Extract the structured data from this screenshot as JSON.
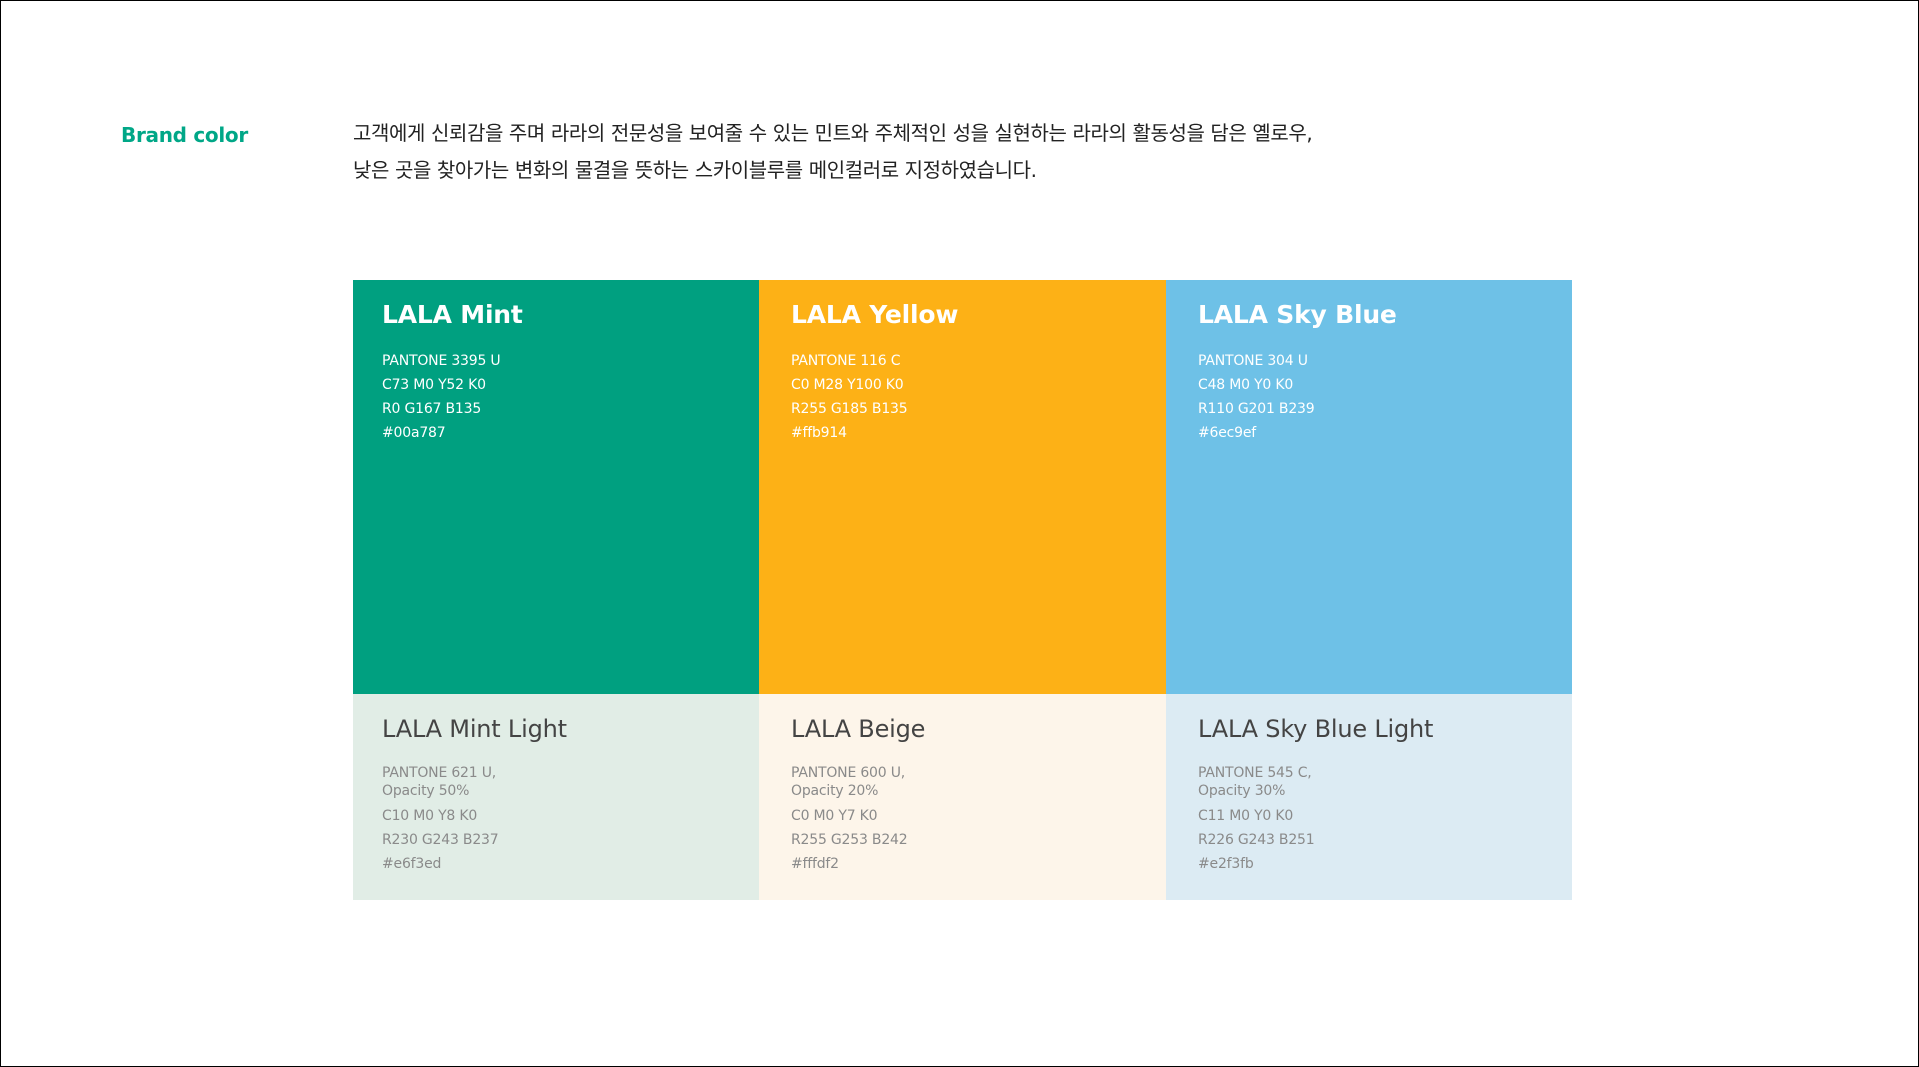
{
  "section_label": "Brand color",
  "accent_color": "#00a787",
  "intro": {
    "line1": "고객에게 신뢰감을 주며 라라의 전문성을 보여줄 수 있는 민트와 주체적인 성을 실현하는 라라의 활동성을 담은 옐로우,",
    "line2": "낮은 곳을 찾아가는 변화의 물결을 뜻하는 스카이블루를 메인컬러로 지정하였습니다."
  },
  "primary": [
    {
      "name": "LALA Mint",
      "pantone": "PANTONE 3395 U",
      "cmyk": "C73 M0 Y52 K0",
      "rgb": "R0 G167 B135",
      "hex": "#00a787",
      "color": "#00a080"
    },
    {
      "name": "LALA Yellow",
      "pantone": "PANTONE 116 C",
      "cmyk": "C0 M28 Y100 K0",
      "rgb": "R255 G185 B135",
      "hex": "#ffb914",
      "color": "#fdb116"
    },
    {
      "name": "LALA Sky Blue",
      "pantone": "PANTONE 304 U",
      "cmyk": "C48 M0 Y0 K0",
      "rgb": "R110 G201 B239",
      "hex": "#6ec9ef",
      "color": "#6ec1e7"
    }
  ],
  "secondary": [
    {
      "name": "LALA Mint Light",
      "pantone": "PANTONE 621 U,",
      "opacity": "Opacity 50%",
      "cmyk": "C10 M0 Y8 K0",
      "rgb": "R230 G243 B237",
      "hex": "#e6f3ed",
      "color": "#e1ede6"
    },
    {
      "name": "LALA Beige",
      "pantone": "PANTONE 600 U,",
      "opacity": "Opacity 20%",
      "cmyk": "C0 M0 Y7 K0",
      "rgb": "R255 G253 B242",
      "hex": "#fffdf2",
      "color": "#fdf5ea"
    },
    {
      "name": "LALA Sky Blue Light",
      "pantone": "PANTONE 545 C,",
      "opacity": "Opacity 30%",
      "cmyk": "C11 M0 Y0 K0",
      "rgb": "R226 G243 B251",
      "hex": "#e2f3fb",
      "color": "#dcebf3"
    }
  ]
}
